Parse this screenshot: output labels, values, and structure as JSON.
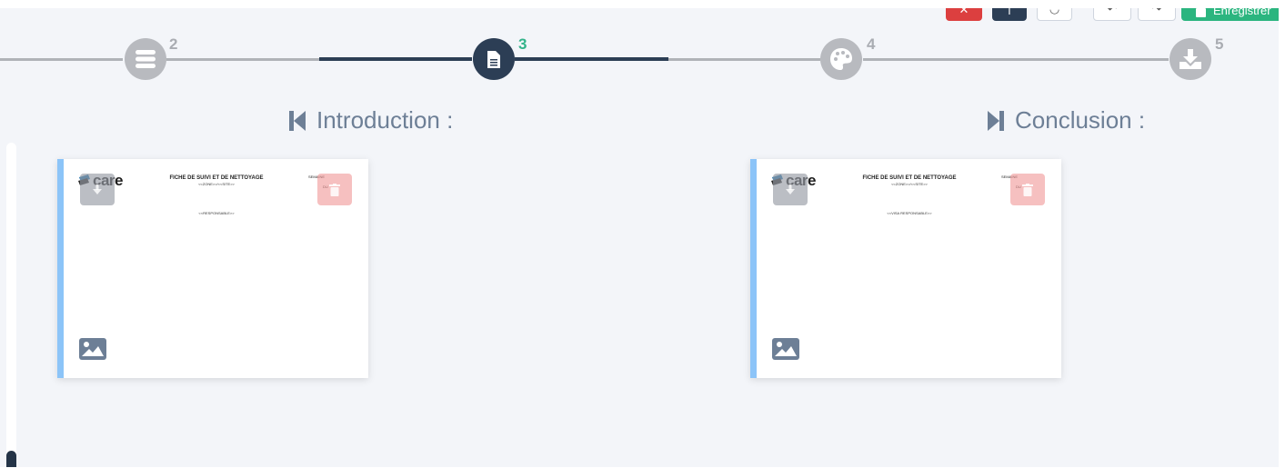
{
  "toolbar": {
    "save_label": "Enregistrer"
  },
  "stepper": {
    "steps": [
      {
        "number": "2",
        "icon": "list-icon"
      },
      {
        "number": "3",
        "icon": "document-icon",
        "active": true
      },
      {
        "number": "4",
        "icon": "palette-icon"
      },
      {
        "number": "5",
        "icon": "download-icon"
      }
    ]
  },
  "sections": {
    "intro": {
      "title": "Introduction :",
      "icon": "step-backward-icon",
      "card": {
        "logo_text": "care",
        "doc_title": "FICHE DE SUIVI ET DE NETTOYAGE",
        "doc_subtitle": "<<ZONE>>/<<SITE>>",
        "doc_body": "<<RESPONSABLE>>",
        "doc_right_top": "SEMAINE",
        "doc_right_bottom": "DU"
      }
    },
    "conclusion": {
      "title": "Conclusion :",
      "icon": "step-forward-icon",
      "card": {
        "logo_text": "care",
        "doc_title": "FICHE DE SUIVI ET DE NETTOYAGE",
        "doc_subtitle": "<<ZONE>>/<<SITE>>",
        "doc_body": "<<VISA RESPONSABLE>>",
        "doc_right_top": "SEMAINE",
        "doc_right_bottom": "DU"
      }
    }
  },
  "colors": {
    "accent_dark": "#2c3e55",
    "active_number": "#33b38a",
    "card_accent": "#8cc4f8",
    "save_green": "#2bb57f",
    "danger_red": "#dc3f3f"
  }
}
